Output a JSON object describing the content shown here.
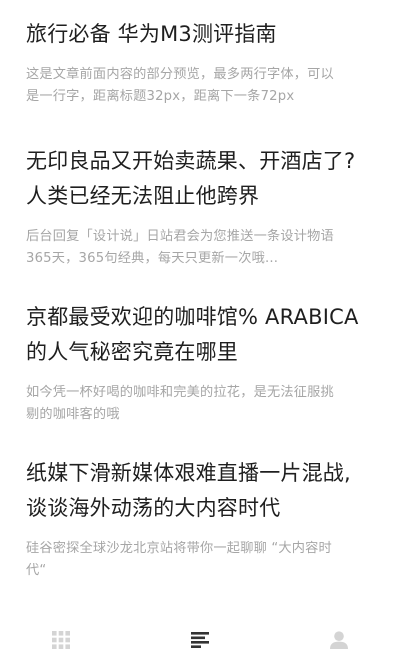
{
  "articles": [
    {
      "title_lines": [
        "旅行必备 华为M3测评指南"
      ],
      "preview_lines": [
        "这是文章前面内容的部分预览，最多两行字体，可以",
        "是一行字，距离标题32px，距离下一条72px"
      ]
    },
    {
      "title_lines": [
        "无印良品又开始卖蔬果、开酒店了?",
        "人类已经无法阻止他跨界"
      ],
      "preview_lines": [
        "后台回复「设计说」日站君会为您推送一条设计物语",
        "365天，365句经典，每天只更新一次哦..."
      ]
    },
    {
      "title_lines": [
        "京都最受欢迎的咖啡馆% ARABICA",
        "的人气秘密究竟在哪里"
      ],
      "preview_lines": [
        "如今凭一杯好喝的咖啡和完美的拉花，是无法征服挑",
        "剔的咖啡客的哦"
      ]
    },
    {
      "title_lines": [
        "纸媒下滑新媒体艰难直播一片混战,",
        "谈谈海外动荡的大内容时代"
      ],
      "preview_lines": [
        "硅谷密探全球沙龙北京站将带你一起聊聊 “大内容时",
        "代“"
      ]
    }
  ],
  "tabbar": {
    "tabs": [
      {
        "icon": "grid-icon",
        "active": false
      },
      {
        "icon": "feed-list-icon",
        "active": true
      },
      {
        "icon": "profile-icon",
        "active": false
      }
    ]
  },
  "colors": {
    "title": "#1f1f1f",
    "preview": "#a6a6a6",
    "tab_inactive": "#d4d4d4",
    "tab_active": "#333333",
    "background": "#ffffff"
  }
}
